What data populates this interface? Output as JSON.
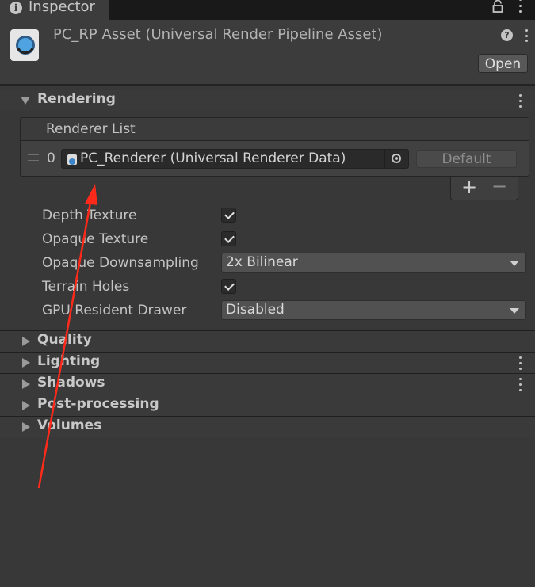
{
  "tab": {
    "title": "Inspector",
    "icon": "info-icon"
  },
  "header": {
    "title": "PC_RP Asset (Universal Render Pipeline Asset)",
    "open_label": "Open",
    "help_icon": "question-icon"
  },
  "rendering": {
    "label": "Rendering",
    "renderer_list": {
      "title": "Renderer List",
      "items": [
        {
          "index": "0",
          "name": "PC_Renderer (Universal Renderer Data)",
          "default_label": "Default"
        }
      ],
      "add": "+",
      "remove": "−"
    },
    "properties": [
      {
        "label": "Depth Texture",
        "type": "toggle",
        "checked": true
      },
      {
        "label": "Opaque Texture",
        "type": "toggle",
        "checked": true
      },
      {
        "label": "Opaque Downsampling",
        "type": "dropdown",
        "value": "2x Bilinear"
      },
      {
        "label": "Terrain Holes",
        "type": "toggle",
        "checked": true
      },
      {
        "label": "GPU Resident Drawer",
        "type": "dropdown",
        "value": "Disabled"
      }
    ]
  },
  "sections": [
    {
      "label": "Quality"
    },
    {
      "label": "Lighting"
    },
    {
      "label": "Shadows"
    },
    {
      "label": "Post-processing"
    },
    {
      "label": "Volumes"
    }
  ],
  "colors": {
    "annotation": "#ff2a1a",
    "background": "#383838"
  }
}
